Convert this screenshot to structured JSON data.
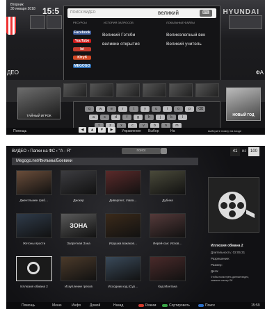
{
  "screen1": {
    "date_line1": "Вторник",
    "date_line2": "30 января 2018",
    "clock": "15:5",
    "brand": "HYUNDAI",
    "search": {
      "placeholder": "ПОИСК ВИДЕО",
      "value": "великий",
      "keyboard_label": "⌨"
    },
    "columns": {
      "services": "РЕСУРСЫ",
      "history": "ИСТОРИЯ ЗАПРОСОВ",
      "local": "ЛОКАЛЬНЫЕ ФАЙЛЫ"
    },
    "services": [
      {
        "label": "Facebook",
        "color": "#3b5998"
      },
      {
        "label": "YouTube",
        "color": "#cc1b1b"
      },
      {
        "label": "Ivi",
        "color": "#c63d2f"
      },
      {
        "label": "Ютуб",
        "color": "#d44a26"
      },
      {
        "label": "MEGOGO",
        "color": "#2c6db3"
      }
    ],
    "history": [
      "Великий Гэтсби",
      "великие открытия"
    ],
    "suggestions": [
      "Великолепный век",
      "Великий учитель"
    ],
    "categories": {
      "left": "ДЕО",
      "right": "ФА"
    },
    "poster_left_caption": "ТАЙНЫЙ ИГРОК",
    "poster_right_caption": "НОВЫЙ ГОД",
    "keyboard_rows": [
      [
        "q",
        "w",
        "e",
        "r",
        "t",
        "y",
        "u",
        "i",
        "o",
        "p",
        "⌫"
      ],
      [
        "a",
        "s",
        "d",
        "f",
        "g",
        "h",
        "j",
        "k",
        "l"
      ],
      [
        "⇧",
        "z",
        "x",
        "c",
        "v",
        "b",
        "n",
        "m"
      ]
    ],
    "bottom": {
      "help": "Помощь",
      "manage": "Управление",
      "select": "Выбор",
      "back": "На",
      "hint": "выберите номер на входе"
    }
  },
  "screen2": {
    "breadcrumb": "ВИДЕО › Папки на ФС › \"А - Я\"",
    "search_label": "поиск",
    "pager": {
      "current": "41",
      "sep": "из",
      "total": "100"
    },
    "path": "Megogo.net/Фильмы/Боевики",
    "tiles": [
      "Джентльмен граб…",
      "Джокер",
      "Дивергент, глава…",
      "Дубина",
      "Жетоны ярости",
      "Запретная Зона",
      "Игрушка вожаков…",
      "Иерей-сан: Испов…",
      "Иллюзия обмана 2",
      "Искупление грехов",
      "Исходник код (Сур…",
      "Кид Монтана"
    ],
    "tile_texts": [
      "",
      "",
      "",
      "",
      "",
      "ЗОНА",
      "",
      "",
      "",
      "",
      "",
      ""
    ],
    "info": {
      "title": "Иллюзия обмана 2",
      "lines": [
        "Длительность: 02:05:31",
        "Разрешение:",
        "Размер:",
        "Дата:",
        "Чтобы посмотреть данные видео, нажмите кнопку ОК"
      ]
    },
    "bottom": {
      "help": "Помощь",
      "menu": "Меню",
      "info": "Инфо",
      "home": "Домой",
      "back": "Назад",
      "mode": "Режим",
      "sort": "Сортировать",
      "search": "Поиск",
      "time": "15:59"
    },
    "colors": {
      "red": "#d23a2a",
      "green": "#3aa546",
      "yellow": "#e0c12a",
      "blue": "#2b6fc7"
    }
  }
}
